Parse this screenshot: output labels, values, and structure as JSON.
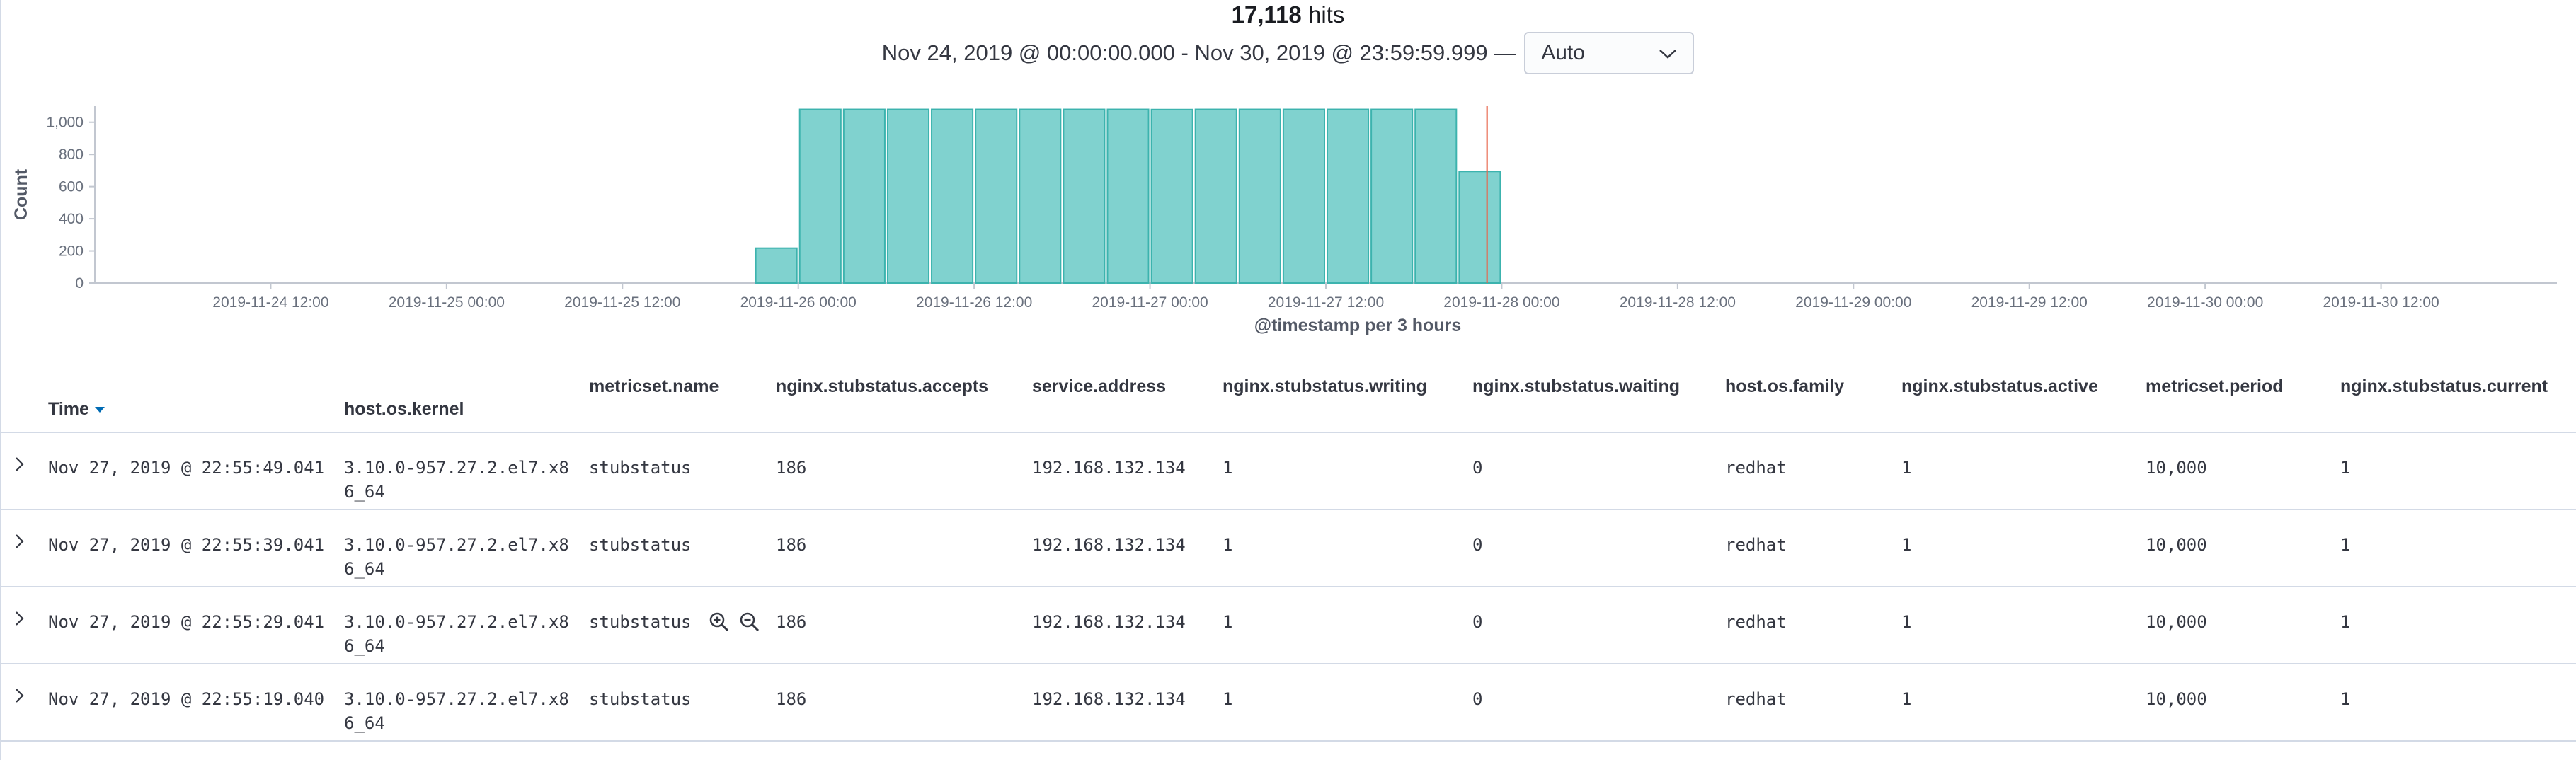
{
  "hits": {
    "count": "17,118",
    "label": "hits"
  },
  "time_range": {
    "text": "Nov 24, 2019 @ 00:00:00.000 - Nov 30, 2019 @ 23:59:59.999 —",
    "interval_value": "Auto"
  },
  "chart_data": {
    "type": "bar",
    "title": "",
    "xlabel": "@timestamp per 3 hours",
    "ylabel": "Count",
    "ylim": [
      0,
      1100
    ],
    "y_ticks": [
      "0",
      "200",
      "400",
      "600",
      "800",
      "1,000"
    ],
    "x_tick_labels": [
      "2019-11-24 12:00",
      "2019-11-25 00:00",
      "2019-11-25 12:00",
      "2019-11-26 00:00",
      "2019-11-26 12:00",
      "2019-11-27 00:00",
      "2019-11-27 12:00",
      "2019-11-28 00:00",
      "2019-11-28 12:00",
      "2019-11-29 00:00",
      "2019-11-29 12:00",
      "2019-11-30 00:00",
      "2019-11-30 12:00"
    ],
    "x_range": [
      "2019-11-24 00:00",
      "2019-12-01 00:00"
    ],
    "bar_interval": "3 hours",
    "categories": [
      "2019-11-25 21:00",
      "2019-11-26 00:00",
      "2019-11-26 03:00",
      "2019-11-26 06:00",
      "2019-11-26 09:00",
      "2019-11-26 12:00",
      "2019-11-26 15:00",
      "2019-11-26 18:00",
      "2019-11-26 21:00",
      "2019-11-27 00:00",
      "2019-11-27 03:00",
      "2019-11-27 06:00",
      "2019-11-27 09:00",
      "2019-11-27 12:00",
      "2019-11-27 15:00",
      "2019-11-27 18:00",
      "2019-11-27 21:00"
    ],
    "values": [
      217,
      1080,
      1080,
      1080,
      1080,
      1080,
      1080,
      1080,
      1080,
      1079,
      1080,
      1080,
      1080,
      1080,
      1080,
      1080,
      694
    ],
    "current_time_marker": "2019-11-27 23:00",
    "grid": false,
    "colors": {
      "bar": "#80d2cf",
      "bar_stroke": "#3cb3ae",
      "marker": "#e7664c"
    }
  },
  "table": {
    "columns": [
      "Time",
      "host.os.kernel",
      "metricset.name",
      "nginx.stubstatus.accepts",
      "service.address",
      "nginx.stubstatus.writing",
      "nginx.stubstatus.waiting",
      "host.os.family",
      "nginx.stubstatus.active",
      "metricset.period",
      "nginx.stubstatus.current"
    ],
    "rows": [
      {
        "time": "Nov 27, 2019 @ 22:55:49.041",
        "kernel_1": "3.10.0-957.27.2.el7.x8",
        "kernel_2": "6_64",
        "metricset": "stubstatus",
        "accepts": "186",
        "address": "192.168.132.134",
        "writing": "1",
        "waiting": "0",
        "family": "redhat",
        "active": "1",
        "period": "10,000",
        "current": "1"
      },
      {
        "time": "Nov 27, 2019 @ 22:55:39.041",
        "kernel_1": "3.10.0-957.27.2.el7.x8",
        "kernel_2": "6_64",
        "metricset": "stubstatus",
        "accepts": "186",
        "address": "192.168.132.134",
        "writing": "1",
        "waiting": "0",
        "family": "redhat",
        "active": "1",
        "period": "10,000",
        "current": "1"
      },
      {
        "time": "Nov 27, 2019 @ 22:55:29.041",
        "kernel_1": "3.10.0-957.27.2.el7.x8",
        "kernel_2": "6_64",
        "metricset": "stubstatus",
        "accepts": "186",
        "address": "192.168.132.134",
        "writing": "1",
        "waiting": "0",
        "family": "redhat",
        "active": "1",
        "period": "10,000",
        "current": "1"
      },
      {
        "time": "Nov 27, 2019 @ 22:55:19.040",
        "kernel_1": "3.10.0-957.27.2.el7.x8",
        "kernel_2": "6_64",
        "metricset": "stubstatus",
        "accepts": "186",
        "address": "192.168.132.134",
        "writing": "1",
        "waiting": "0",
        "family": "redhat",
        "active": "1",
        "period": "10,000",
        "current": "1"
      }
    ],
    "hover_icons": [
      "magnify-plus-icon",
      "magnify-minus-icon"
    ]
  }
}
